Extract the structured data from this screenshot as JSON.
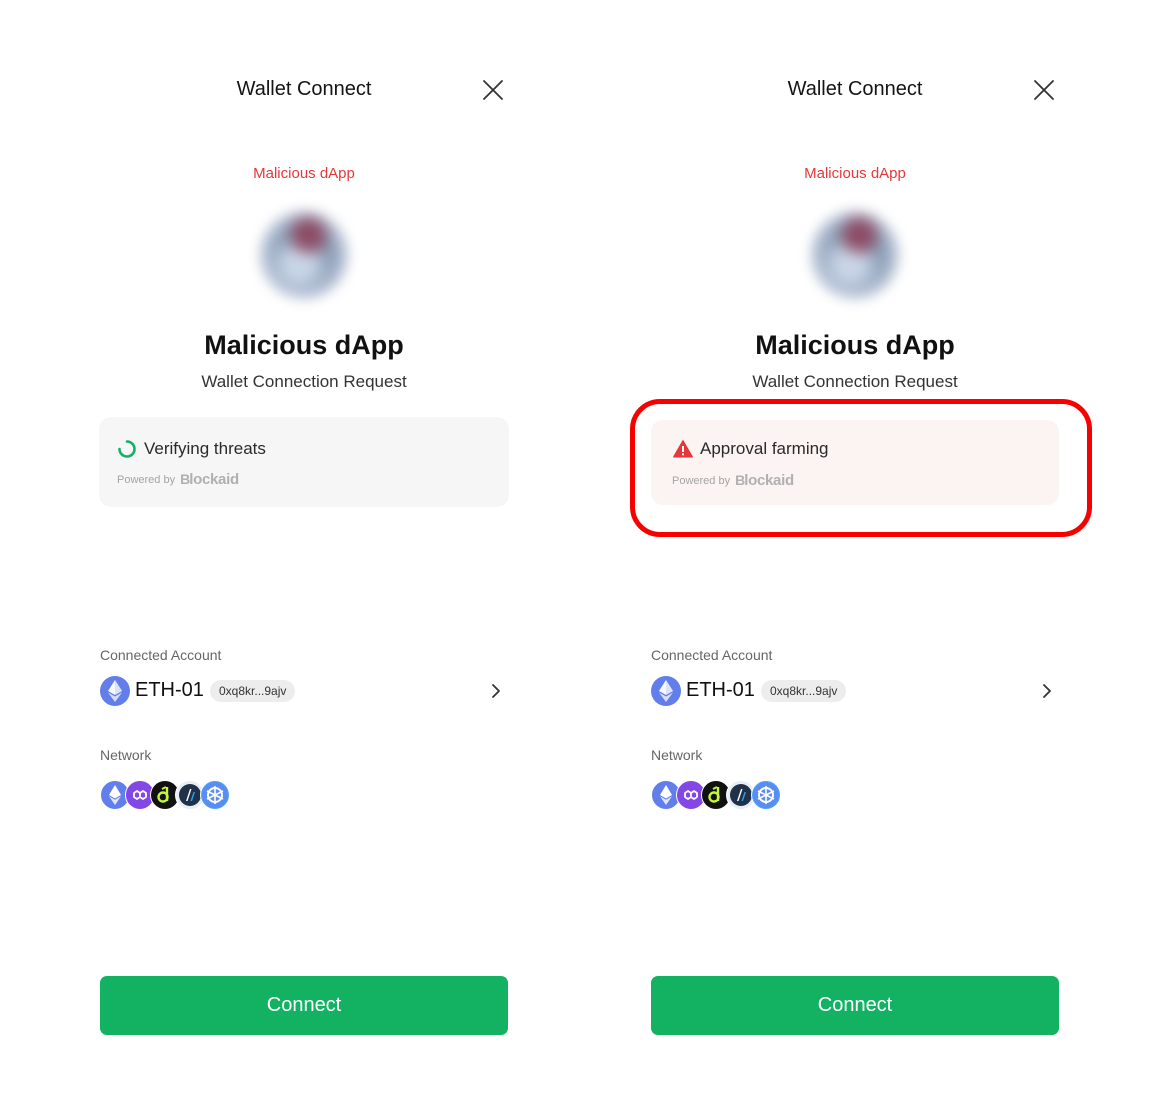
{
  "panels": [
    {
      "header": {
        "title": "Wallet Connect"
      },
      "dapp": {
        "tag": "Malicious dApp",
        "name": "Malicious dApp",
        "subtitle": "Wallet Connection Request"
      },
      "threat": {
        "status": "loading",
        "icon": "spinner-icon",
        "message": "Verifying threats",
        "powered_by": "Powered by",
        "brand": "lockaid",
        "brand_mark": "B"
      },
      "account": {
        "label": "Connected Account",
        "name": "ETH-01",
        "address": "0xq8kr...9ajv"
      },
      "network": {
        "label": "Network",
        "icons": [
          "ethereum-icon",
          "polygon-icon",
          "gnosis-icon",
          "arbitrum-icon",
          "linea-icon"
        ]
      },
      "connect_label": "Connect"
    },
    {
      "header": {
        "title": "Wallet Connect"
      },
      "dapp": {
        "tag": "Malicious dApp",
        "name": "Malicious dApp",
        "subtitle": "Wallet Connection Request"
      },
      "threat": {
        "status": "warning",
        "icon": "warning-triangle-icon",
        "message": "Approval farming",
        "powered_by": "Powered by",
        "brand": "lockaid",
        "brand_mark": "B"
      },
      "account": {
        "label": "Connected Account",
        "name": "ETH-01",
        "address": "0xq8kr...9ajv"
      },
      "network": {
        "label": "Network",
        "icons": [
          "ethereum-icon",
          "polygon-icon",
          "gnosis-icon",
          "arbitrum-icon",
          "linea-icon"
        ]
      },
      "connect_label": "Connect"
    }
  ],
  "colors": {
    "danger": "#e5383b",
    "connect": "#12b262",
    "highlight": "#f70000",
    "eth": "#627eea"
  }
}
